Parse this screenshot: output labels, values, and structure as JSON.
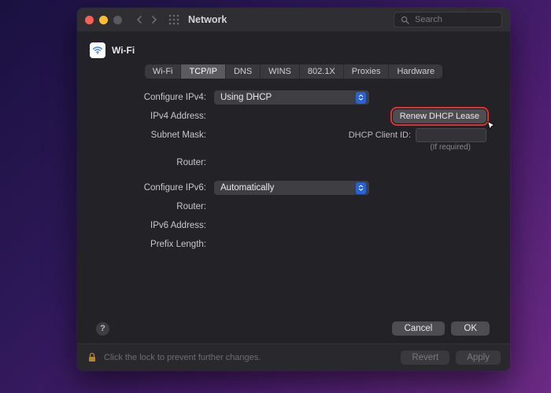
{
  "window": {
    "title": "Network"
  },
  "search": {
    "placeholder": "Search"
  },
  "context": {
    "label": "Wi-Fi"
  },
  "tabs": [
    "Wi-Fi",
    "TCP/IP",
    "DNS",
    "WINS",
    "802.1X",
    "Proxies",
    "Hardware"
  ],
  "active_tab_index": 1,
  "form": {
    "configure_ipv4_label": "Configure IPv4:",
    "configure_ipv4_value": "Using DHCP",
    "ipv4_address_label": "IPv4 Address:",
    "subnet_mask_label": "Subnet Mask:",
    "router_label": "Router:",
    "renew_button": "Renew DHCP Lease",
    "dhcp_client_id_label": "DHCP Client ID:",
    "dhcp_client_id_hint": "(If required)",
    "configure_ipv6_label": "Configure IPv6:",
    "configure_ipv6_value": "Automatically",
    "router6_label": "Router:",
    "ipv6_address_label": "IPv6 Address:",
    "prefix_length_label": "Prefix Length:"
  },
  "buttons": {
    "cancel": "Cancel",
    "ok": "OK",
    "revert": "Revert",
    "apply": "Apply"
  },
  "lock_text": "Click the lock to prevent further changes.",
  "help_glyph": "?"
}
